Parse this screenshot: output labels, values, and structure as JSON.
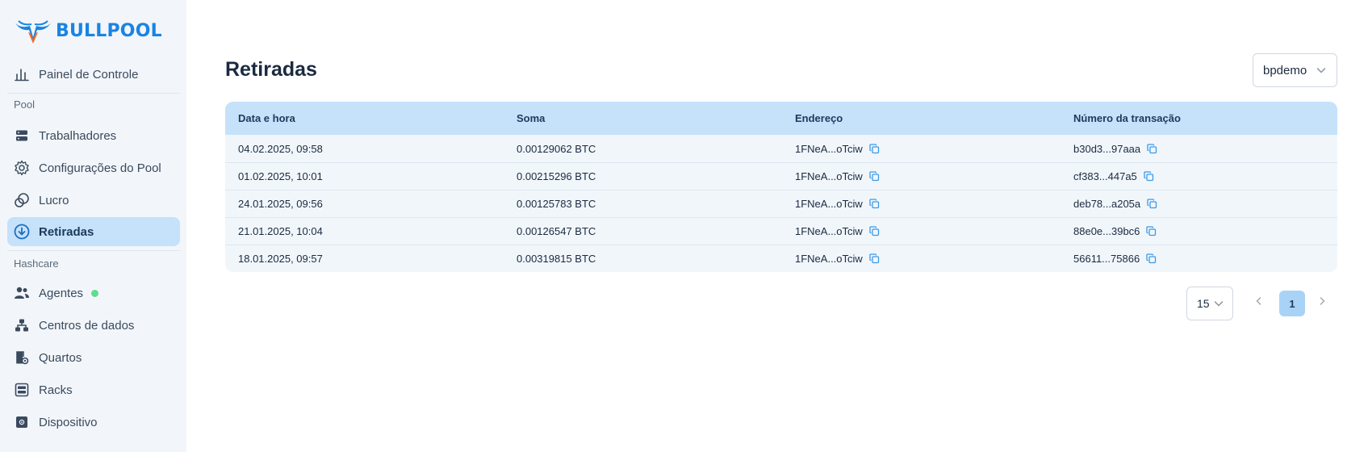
{
  "brand": {
    "name": "BULLPOOL",
    "color": "#1a84e2"
  },
  "sidebar": {
    "items_top": [
      {
        "label": "Painel de Controle",
        "icon": "bar-chart-icon"
      }
    ],
    "section_pool": "Pool",
    "items_pool": [
      {
        "label": "Trabalhadores",
        "icon": "server-icon"
      },
      {
        "label": "Configurações do Pool",
        "icon": "gear-icon"
      },
      {
        "label": "Lucro",
        "icon": "coins-icon"
      },
      {
        "label": "Retiradas",
        "icon": "download-circle-icon",
        "active": true
      }
    ],
    "section_hashcare": "Hashcare",
    "items_hashcare": [
      {
        "label": "Agentes",
        "icon": "users-icon",
        "status": "online"
      },
      {
        "label": "Centros de dados",
        "icon": "hierarchy-icon"
      },
      {
        "label": "Quartos",
        "icon": "room-icon"
      },
      {
        "label": "Racks",
        "icon": "rack-icon"
      },
      {
        "label": "Dispositivo",
        "icon": "device-icon"
      }
    ]
  },
  "page": {
    "title": "Retiradas"
  },
  "account_selector": {
    "value": "bpdemo"
  },
  "table": {
    "headers": [
      "Data e hora",
      "Soma",
      "Endereço",
      "Número da transação"
    ],
    "rows": [
      {
        "date": "04.02.2025, 09:58",
        "amount": "0.00129062 BTC",
        "address": "1FNeA...oTciw",
        "tx": "b30d3...97aaa"
      },
      {
        "date": "01.02.2025, 10:01",
        "amount": "0.00215296 BTC",
        "address": "1FNeA...oTciw",
        "tx": "cf383...447a5"
      },
      {
        "date": "24.01.2025, 09:56",
        "amount": "0.00125783 BTC",
        "address": "1FNeA...oTciw",
        "tx": "deb78...a205a"
      },
      {
        "date": "21.01.2025, 10:04",
        "amount": "0.00126547 BTC",
        "address": "1FNeA...oTciw",
        "tx": "88e0e...39bc6"
      },
      {
        "date": "18.01.2025, 09:57",
        "amount": "0.00319815 BTC",
        "address": "1FNeA...oTciw",
        "tx": "56611...75866"
      }
    ]
  },
  "pagination": {
    "per_page": "15",
    "current_page": "1"
  },
  "colors": {
    "accent": "#1a84e2",
    "active_bg": "#c6e1fa",
    "online": "#5fdc8c"
  }
}
